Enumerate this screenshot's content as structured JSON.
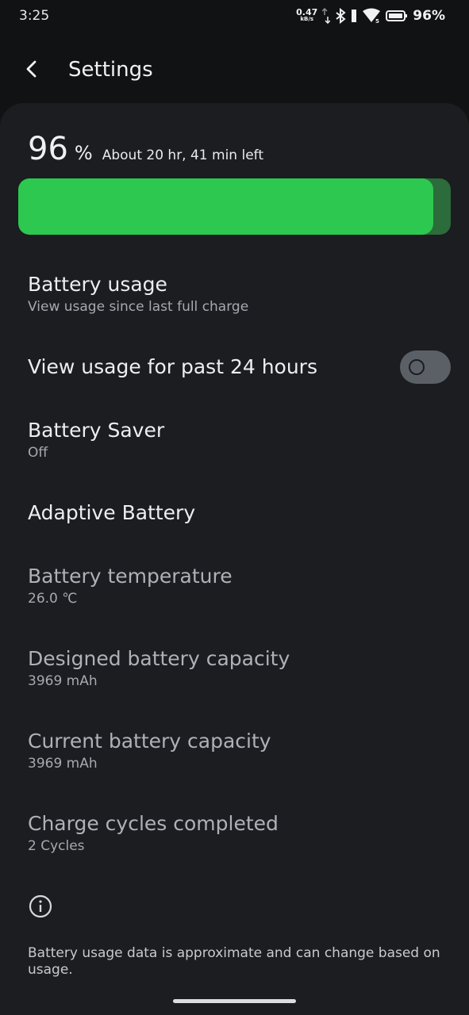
{
  "status": {
    "time": "3:25",
    "net_value": "0.47",
    "net_unit": "kB/s",
    "battery_pct": "96%",
    "icons": [
      "network-speed-arrows-icon",
      "bluetooth-icon",
      "signal-icon",
      "wifi-icon",
      "battery-icon"
    ]
  },
  "appbar": {
    "title": "Settings"
  },
  "battery": {
    "percent": "96",
    "percent_symbol": "%",
    "time_left": "About 20 hr, 41 min left",
    "level": 0.96,
    "fill_color": "#2cc84f"
  },
  "items": {
    "usage": {
      "title": "Battery usage",
      "subtitle": "View usage since last full charge"
    },
    "past24": {
      "title": "View usage for past 24 hours",
      "toggle": "off"
    },
    "saver": {
      "title": "Battery Saver",
      "subtitle": "Off"
    },
    "adaptive": {
      "title": "Adaptive Battery"
    },
    "temperature": {
      "title": "Battery temperature",
      "subtitle": "26.0 ℃"
    },
    "designed": {
      "title": "Designed battery capacity",
      "subtitle": "3969 mAh"
    },
    "current": {
      "title": "Current battery capacity",
      "subtitle": "3969 mAh"
    },
    "cycles": {
      "title": "Charge cycles completed",
      "subtitle": "2 Cycles"
    }
  },
  "footer": {
    "text": "Battery usage data is approximate and can change based on usage."
  }
}
